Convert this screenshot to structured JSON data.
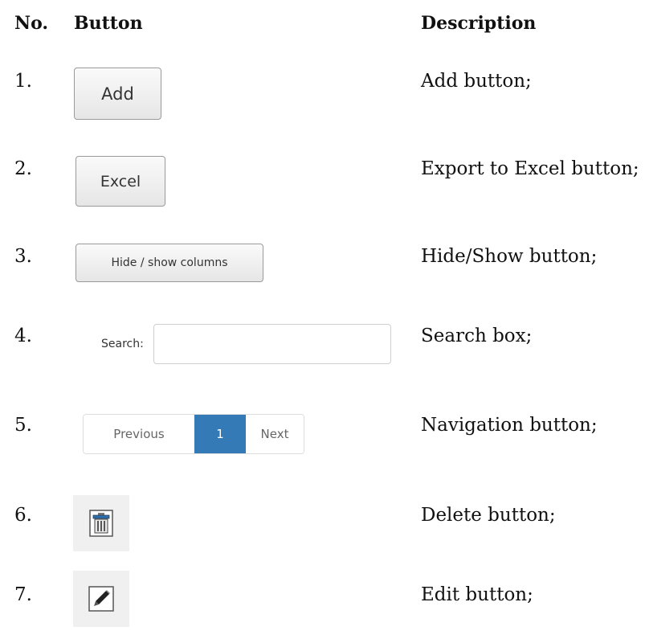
{
  "headers": {
    "no": "No.",
    "button": "Button",
    "description": "Description"
  },
  "rows": [
    {
      "no": "1.",
      "button": "Add",
      "description": "Add button;"
    },
    {
      "no": "2.",
      "button": "Excel",
      "description": "Export to Excel button;"
    },
    {
      "no": "3.",
      "button": "Hide / show columns",
      "description": "Hide/Show button;"
    },
    {
      "no": "4.",
      "button": "Search:",
      "description": "Search box;"
    },
    {
      "no": "5.",
      "button": "",
      "description": "Navigation button;"
    },
    {
      "no": "6.",
      "button": "",
      "description": "Delete button;"
    },
    {
      "no": "7.",
      "button": "",
      "description": "Edit button;"
    }
  ],
  "pagination": {
    "previous": "Previous",
    "current": "1",
    "next": "Next"
  },
  "colors": {
    "pager_active": "#337ab7",
    "button_border": "#9a9a9a"
  },
  "icons": {
    "delete": "trash-icon",
    "edit": "pencil-icon"
  }
}
